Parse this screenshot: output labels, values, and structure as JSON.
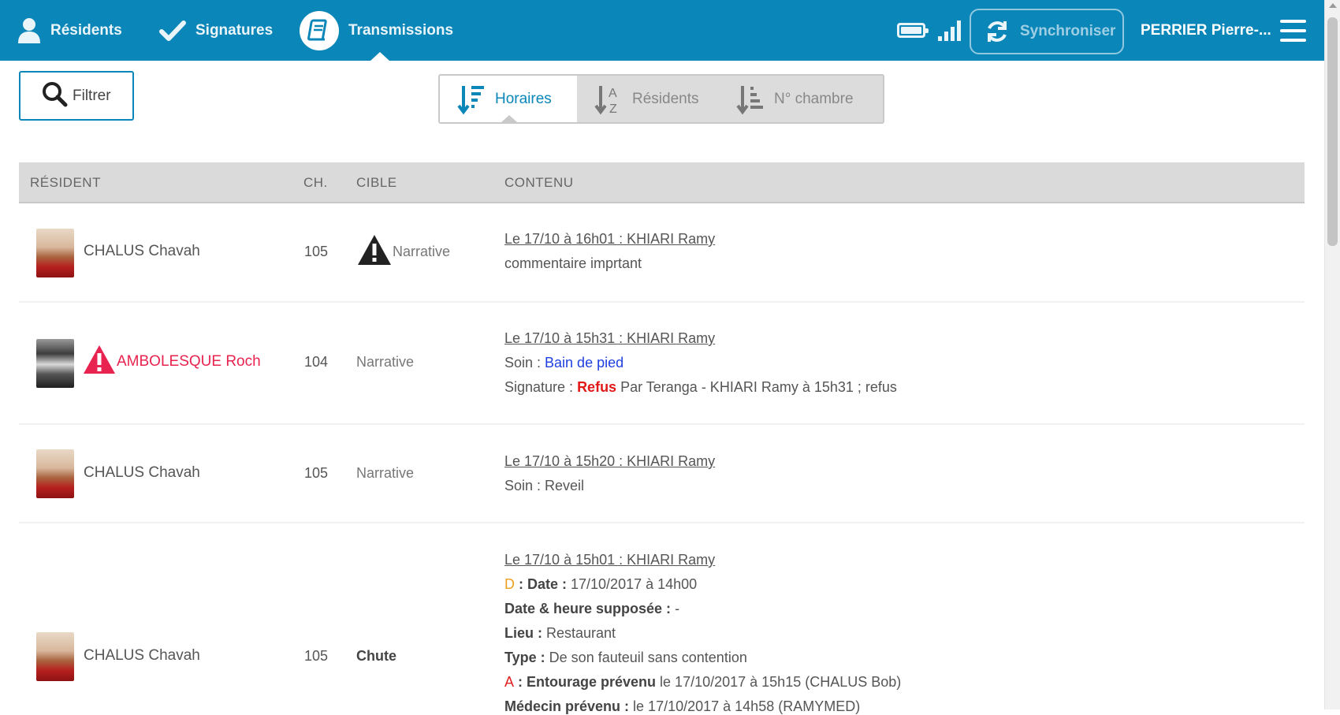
{
  "nav": {
    "residents_label": "Résidents",
    "signatures_label": "Signatures",
    "transmissions_label": "Transmissions",
    "sync_label": "Synchroniser",
    "user_name": "PERRIER Pierre-..."
  },
  "toolbar": {
    "filter_label": "Filtrer",
    "sort_options": [
      "Horaires",
      "Résidents",
      "N° chambre"
    ],
    "active_sort": "Horaires"
  },
  "table": {
    "headers": {
      "resident": "RÉSIDENT",
      "room": "CH.",
      "target": "CIBLE",
      "content": "CONTENU"
    },
    "rows": [
      {
        "resident": "CHALUS Chavah",
        "room": "105",
        "target": "Narrative",
        "header": "Le 17/10 à 16h01 : KHIARI Ramy",
        "text": "commentaire imprtant"
      },
      {
        "resident": "AMBOLESQUE Roch",
        "room": "104",
        "target": "Narrative",
        "header": "Le 17/10 à 15h31 : KHIARI Ramy",
        "soin_label": "Soin : ",
        "soin_value": "Bain de pied",
        "signature_label": "Signature : ",
        "signature_status": "Refus",
        "signature_rest": " Par Teranga - KHIARI Ramy à 15h31 ; refus"
      },
      {
        "resident": "CHALUS Chavah",
        "room": "105",
        "target": "Narrative",
        "header": "Le 17/10 à 15h20 : KHIARI Ramy",
        "text": "Soin : Reveil"
      },
      {
        "resident": "CHALUS Chavah",
        "room": "105",
        "target": "Chute",
        "header": "Le 17/10 à 15h01 : KHIARI Ramy",
        "d_letter": "D",
        "date_label": " : Date : ",
        "date_value": "17/10/2017 à 14h00",
        "date_supposee_label": "Date & heure supposée : ",
        "date_supposee_value": "-",
        "lieu_label": "Lieu : ",
        "lieu_value": "Restaurant",
        "type_label": "Type : ",
        "type_value": "De son fauteuil sans contention",
        "a_letter": "A",
        "entourage_label": " : Entourage prévenu",
        "entourage_value": " le 17/10/2017 à 15h15 (CHALUS Bob)",
        "medecin_label": "Médecin prévenu : ",
        "medecin_value": "le 17/10/2017 à 14h58 (RAMYMED)"
      }
    ]
  },
  "colors": {
    "nav_background": "#0b86b8",
    "alert_red": "#e8234f",
    "link_blue": "#1e3fe0",
    "refus_red": "#e01818",
    "d_orange": "#f0a020"
  }
}
